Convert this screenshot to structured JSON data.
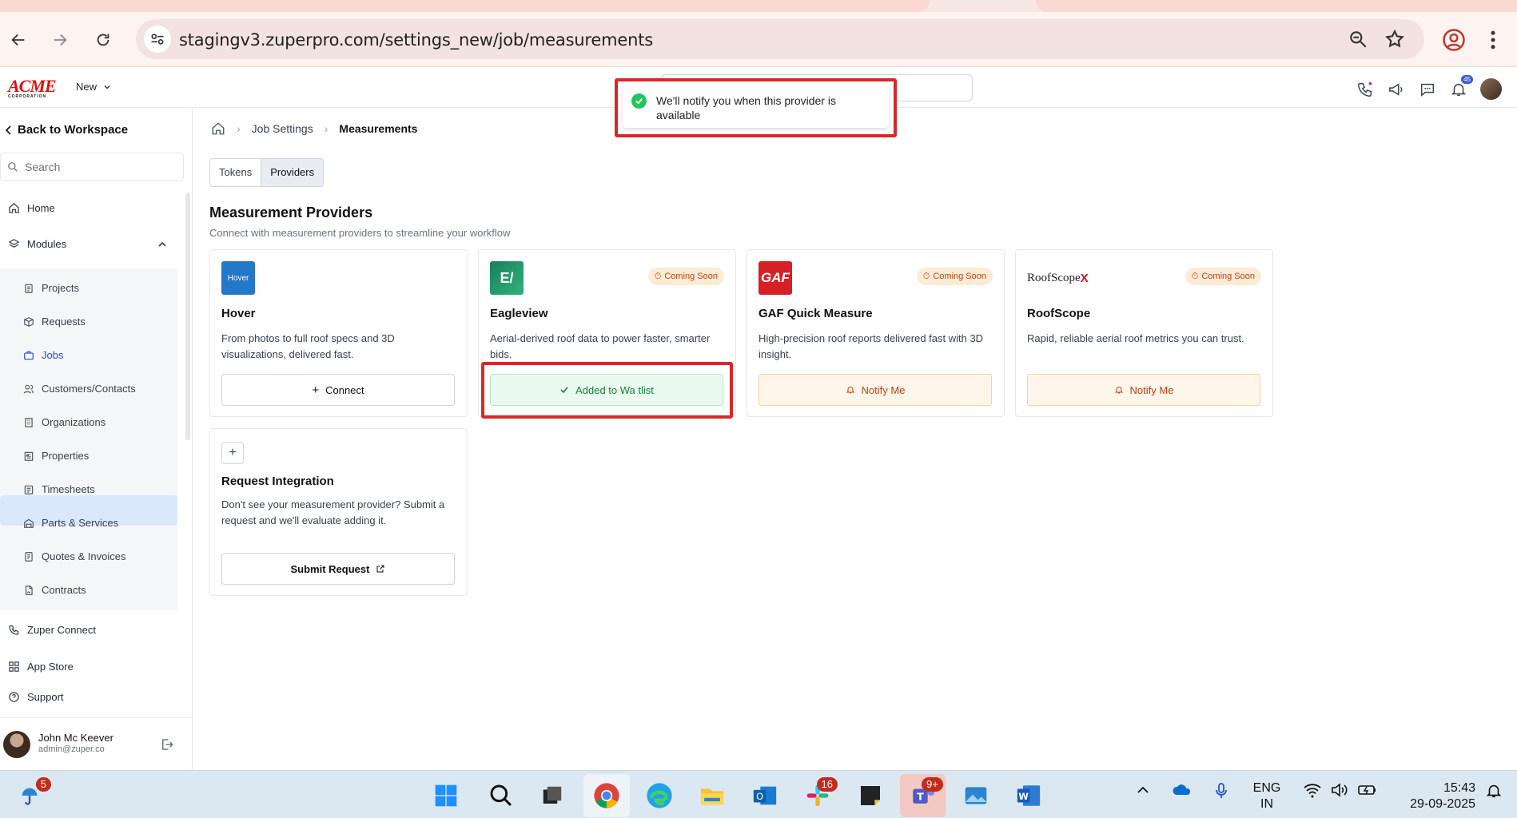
{
  "browser": {
    "url": "stagingv3.zuperpro.com/settings_new/job/measurements"
  },
  "header": {
    "logo_text": "ACME",
    "logo_sub": "CORPORATION",
    "new_label": "New",
    "notif_count": "45"
  },
  "toast": {
    "message": "We'll notify you when this provider is available"
  },
  "sidebar": {
    "back_label": "Back to Workspace",
    "search_placeholder": "Search",
    "home": "Home",
    "modules": "Modules",
    "items": [
      "Projects",
      "Requests",
      "Jobs",
      "Customers/Contacts",
      "Organizations",
      "Properties",
      "Timesheets",
      "Parts & Services",
      "Quotes & Invoices",
      "Contracts"
    ],
    "zuper_connect": "Zuper Connect",
    "app_store": "App Store",
    "support": "Support",
    "user_name": "John Mc Keever",
    "user_email": "admin@zuper.co"
  },
  "breadcrumb": {
    "job_settings": "Job Settings",
    "current": "Measurements"
  },
  "tabs": {
    "tokens": "Tokens",
    "providers": "Providers"
  },
  "section": {
    "title": "Measurement Providers",
    "subtitle": "Connect with measurement providers to streamline your workflow"
  },
  "providers": [
    {
      "name": "Hover",
      "logo": "Hover",
      "desc": "From photos to full roof specs and 3D visualizations, delivered fast.",
      "button": "Connect"
    },
    {
      "name": "Eagleview",
      "logo": "E/",
      "badge": "Coming Soon",
      "desc": "Aerial-derived roof data to power faster, smarter bids.",
      "button": "Added to Wa tlist"
    },
    {
      "name": "GAF Quick Measure",
      "logo": "GAF",
      "badge": "Coming Soon",
      "desc": "High-precision roof reports delivered fast with 3D insight.",
      "button": "Notify Me"
    },
    {
      "name": "RoofScope",
      "logo": "RoofScope",
      "logo_x": "X",
      "badge": "Coming Soon",
      "desc": "Rapid, reliable aerial roof metrics you can trust.",
      "button": "Notify Me"
    }
  ],
  "request": {
    "title": "Request Integration",
    "desc": "Don't see your measurement provider? Submit a request and we'll evaluate adding it.",
    "button": "Submit Request"
  },
  "taskbar": {
    "weather_badge": "5",
    "slack_badge": "16",
    "teams_badge": "9+",
    "lang_1": "ENG",
    "lang_2": "IN",
    "time": "15:43",
    "date": "29-09-2025"
  },
  "colors": {
    "accent_blue": "#3b5bdb",
    "active_nav_bg": "#dbe8fb",
    "coming_soon": "#c2410c",
    "success": "#22c55e",
    "highlight_red": "#dc2626"
  }
}
